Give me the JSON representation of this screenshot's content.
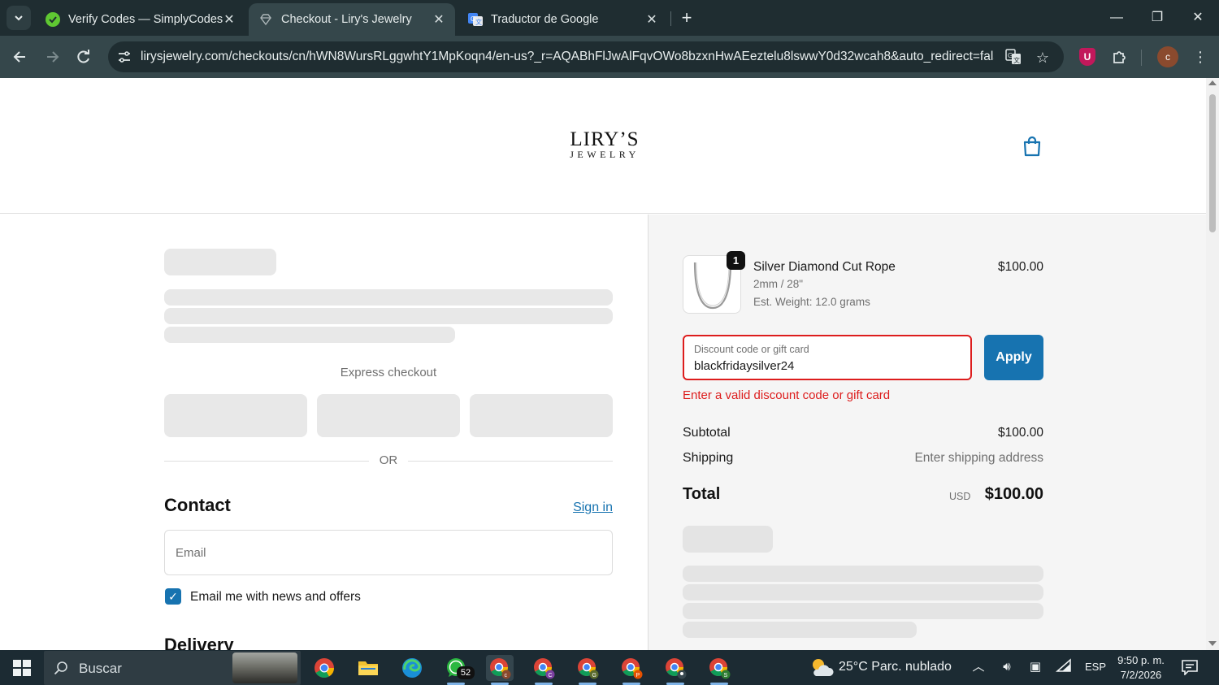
{
  "browser": {
    "tabs": [
      {
        "title": "Verify Codes — SimplyCodes",
        "favicon": "simplycodes-icon"
      },
      {
        "title": "Checkout - Liry's Jewelry",
        "favicon": "liry-gem-icon",
        "active": true
      },
      {
        "title": "Traductor de Google",
        "favicon": "google-translate-icon"
      }
    ],
    "url": "lirysjewelry.com/checkouts/cn/hWN8WursRLggwhtY1MpKoqn4/en-us?_r=AQABhFlJwAlFqvOWo8bzxnHwAEeztelu8lswwY0d32wcah8&auto_redirect=fals...",
    "profile_initial": "c",
    "extension_label": "U"
  },
  "store": {
    "logo_top": "LIRY’S",
    "logo_bottom": "JEWELRY"
  },
  "checkout": {
    "express_label": "Express checkout",
    "or_label": "OR",
    "contact_heading": "Contact",
    "sign_in": "Sign in",
    "email_placeholder": "Email",
    "newsletter_label": "Email me with news and offers",
    "newsletter_checked": true,
    "delivery_heading": "Delivery"
  },
  "summary": {
    "product": {
      "name": "Silver Diamond Cut Rope",
      "variant": "2mm / 28\"",
      "weight": "Est. Weight: 12.0 grams",
      "price": "$100.00",
      "quantity": "1"
    },
    "discount": {
      "label": "Discount code or gift card",
      "value": "blackfridaysilver24",
      "apply": "Apply",
      "error": "Enter a valid discount code or gift card"
    },
    "subtotal_label": "Subtotal",
    "subtotal_value": "$100.00",
    "shipping_label": "Shipping",
    "shipping_value": "Enter shipping address",
    "total_label": "Total",
    "total_currency": "USD",
    "total_value": "$100.00"
  },
  "taskbar": {
    "search_text": "Buscar",
    "whatsapp_badge": "52",
    "weather": "25°C  Parc. nublado",
    "language": "ESP",
    "time": "9:50 p. m.",
    "date": "7/2/2026"
  },
  "colors": {
    "accent": "#1773b0",
    "error": "#dd1d1d",
    "chrome_bg": "#1f2d31",
    "taskbar_bg": "#1c2b33"
  }
}
